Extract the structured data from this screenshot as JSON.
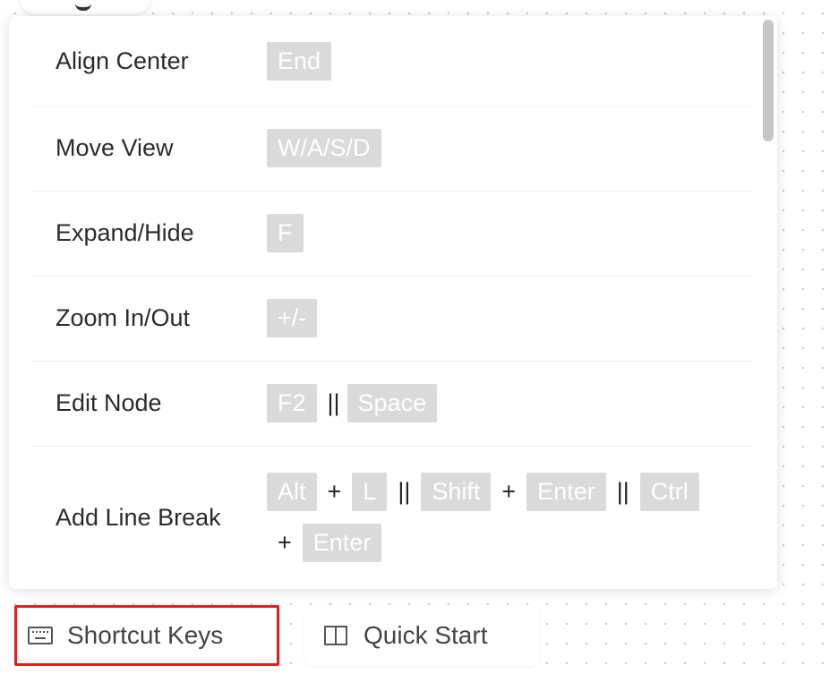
{
  "shortcuts": {
    "rows": [
      {
        "label": "Align Center",
        "keys": [
          "End"
        ]
      },
      {
        "label": "Move View",
        "keys": [
          "W/A/S/D"
        ]
      },
      {
        "label": "Expand/Hide",
        "keys": [
          "F"
        ]
      },
      {
        "label": "Zoom In/Out",
        "keys": [
          "+/-"
        ]
      },
      {
        "label": "Edit Node",
        "keys": [
          "F2",
          "Space"
        ],
        "separator": "||"
      },
      {
        "label": "Add Line Break",
        "keys": [
          "Alt",
          "L",
          "Shift",
          "Enter",
          "Ctrl",
          "Enter"
        ],
        "plus": "+",
        "separator": "||"
      }
    ]
  },
  "bottom_bar": {
    "shortcut_keys_label": "Shortcut Keys",
    "shortcut_keys_icon": "keyboard-icon",
    "quick_start_label": "Quick Start",
    "quick_start_icon": "book-icon",
    "highlight_color": "#e02020"
  },
  "colors": {
    "key_background": "#dadada",
    "key_text": "#ffffff"
  }
}
